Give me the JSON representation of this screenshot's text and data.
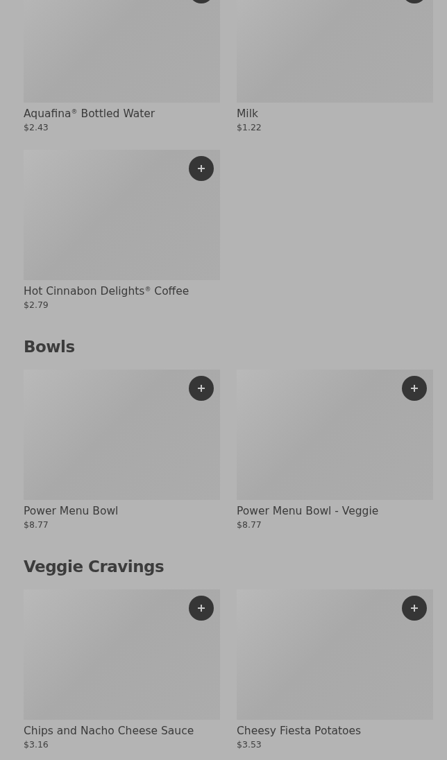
{
  "sections": [
    {
      "items": [
        {
          "name": "Aquafina$^{®}$ Bottled Water",
          "price": "$2.43",
          "cut": true
        },
        {
          "name": "Milk",
          "price": "$1.22",
          "cut": true
        },
        {
          "name": "Hot Cinnabon Delights$^{®}$ Coffee",
          "price": "$2.79"
        }
      ]
    },
    {
      "title": "Bowls",
      "items": [
        {
          "name": "Power Menu Bowl",
          "price": "$8.77"
        },
        {
          "name": "Power Menu Bowl - Veggie",
          "price": "$8.77"
        }
      ]
    },
    {
      "title": "Veggie Cravings",
      "items": [
        {
          "name": "Chips and Nacho Cheese Sauce",
          "price": "$3.16"
        },
        {
          "name": "Cheesy Fiesta Potatoes",
          "price": "$3.53"
        }
      ]
    }
  ]
}
